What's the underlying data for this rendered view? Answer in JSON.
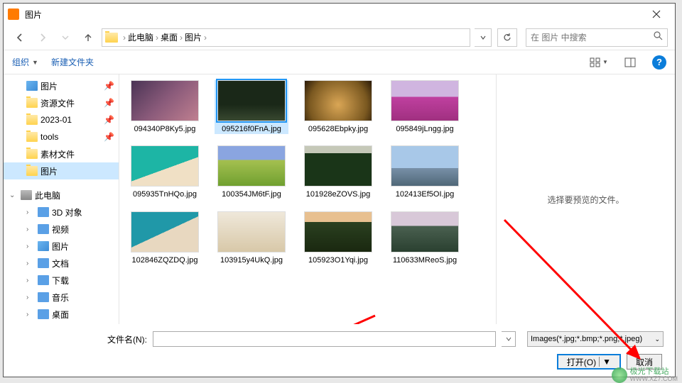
{
  "window": {
    "title": "图片"
  },
  "nav": {
    "path_root": "此电脑",
    "path_parts": [
      "桌面",
      "图片"
    ],
    "search_placeholder": "在 图片 中搜索"
  },
  "toolbar": {
    "organize": "组织",
    "new_folder": "新建文件夹"
  },
  "sidebar": {
    "quick": [
      {
        "label": "图片",
        "icon": "img",
        "pinned": true
      },
      {
        "label": "资源文件",
        "icon": "folder",
        "pinned": true
      },
      {
        "label": "2023-01",
        "icon": "folder",
        "pinned": true
      },
      {
        "label": "tools",
        "icon": "folder",
        "pinned": true
      },
      {
        "label": "素材文件",
        "icon": "folder"
      },
      {
        "label": "图片",
        "icon": "folder",
        "selected": true
      }
    ],
    "this_pc": "此电脑",
    "pc_children": [
      {
        "label": "3D 对象",
        "icon": "drive"
      },
      {
        "label": "视频",
        "icon": "drive"
      },
      {
        "label": "图片",
        "icon": "img"
      },
      {
        "label": "文档",
        "icon": "drive"
      },
      {
        "label": "下载",
        "icon": "drive"
      },
      {
        "label": "音乐",
        "icon": "drive"
      },
      {
        "label": "桌面",
        "icon": "drive"
      }
    ]
  },
  "files": [
    {
      "name": "094340P8Ky5.jpg",
      "cls": "t1"
    },
    {
      "name": "095216f0FnA.jpg",
      "cls": "t2",
      "selected": true
    },
    {
      "name": "095628Ebpky.jpg",
      "cls": "t3"
    },
    {
      "name": "095849jLngg.jpg",
      "cls": "t4"
    },
    {
      "name": "095935TnHQo.jpg",
      "cls": "t5"
    },
    {
      "name": "100354JM6tF.jpg",
      "cls": "t6"
    },
    {
      "name": "101928eZOVS.jpg",
      "cls": "t7"
    },
    {
      "name": "102413Ef5OI.jpg",
      "cls": "t8"
    },
    {
      "name": "102846ZQZDQ.jpg",
      "cls": "t9"
    },
    {
      "name": "103915y4UkQ.jpg",
      "cls": "t10"
    },
    {
      "name": "105923O1Yqi.jpg",
      "cls": "t11"
    },
    {
      "name": "110633MReoS.jpg",
      "cls": "t12"
    }
  ],
  "preview": {
    "empty_text": "选择要预览的文件。"
  },
  "footer": {
    "filename_label": "文件名(N):",
    "filter": "Images(*.jpg;*.bmp;*.png;*.jpeg)",
    "open": "打开(O)",
    "cancel": "取消"
  },
  "watermark": {
    "name": "极光下载站",
    "url": "WWW.XZ7.COM"
  }
}
